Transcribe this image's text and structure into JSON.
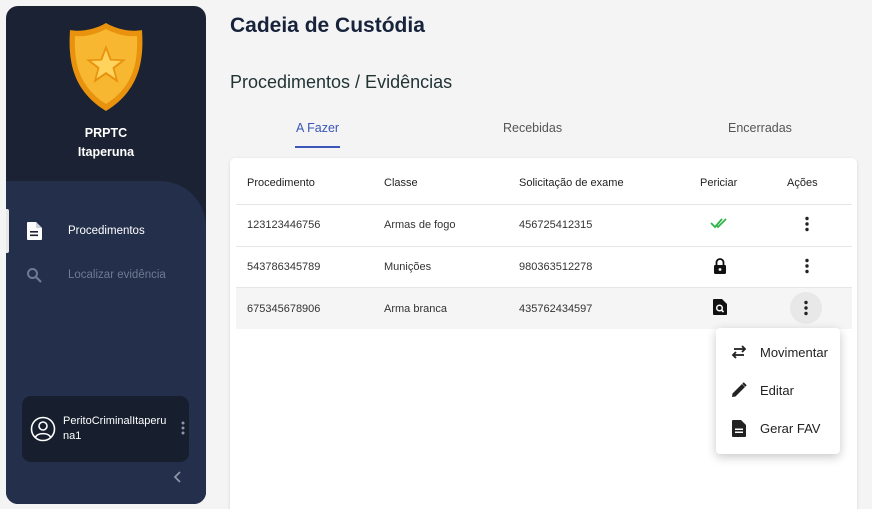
{
  "sidebar": {
    "org_line1": "PRPTC",
    "org_line2": "Itaperuna",
    "nav": [
      {
        "label": "Procedimentos",
        "icon": "document-icon",
        "active": true
      },
      {
        "label": "Localizar evidência",
        "icon": "search-icon",
        "active": false
      }
    ],
    "user": {
      "name": "PeritoCriminalItaperuna1"
    }
  },
  "header": {
    "title": "Cadeia de Custódia",
    "breadcrumb": "Procedimentos / Evidências"
  },
  "tabs": [
    {
      "label": "A Fazer",
      "active": true
    },
    {
      "label": "Recebidas",
      "active": false
    },
    {
      "label": "Encerradas",
      "active": false
    }
  ],
  "table": {
    "columns": [
      "Procedimento",
      "Classe",
      "Solicitação de exame",
      "Periciar",
      "Ações"
    ],
    "rows": [
      {
        "procedimento": "123123446756",
        "classe": "Armas de fogo",
        "solicitacao": "456725412315",
        "periciar_icon": "double-check-icon"
      },
      {
        "procedimento": "543786345789",
        "classe": "Munições",
        "solicitacao": "980363512278",
        "periciar_icon": "lock-icon"
      },
      {
        "procedimento": "675345678906",
        "classe": "Arma branca",
        "solicitacao": "435762434597",
        "periciar_icon": "document-search-icon"
      }
    ]
  },
  "menu": {
    "items": [
      {
        "label": "Movimentar",
        "icon": "swap-arrows-icon"
      },
      {
        "label": "Editar",
        "icon": "pencil-icon"
      },
      {
        "label": "Gerar FAV",
        "icon": "document-icon"
      }
    ]
  },
  "colors": {
    "sidebar_bg": "#1b2233",
    "sidebar_panel": "#232f4b",
    "accent": "#3a56b8",
    "check_green": "#2fb44a",
    "badge_gold": "#f5a623"
  }
}
